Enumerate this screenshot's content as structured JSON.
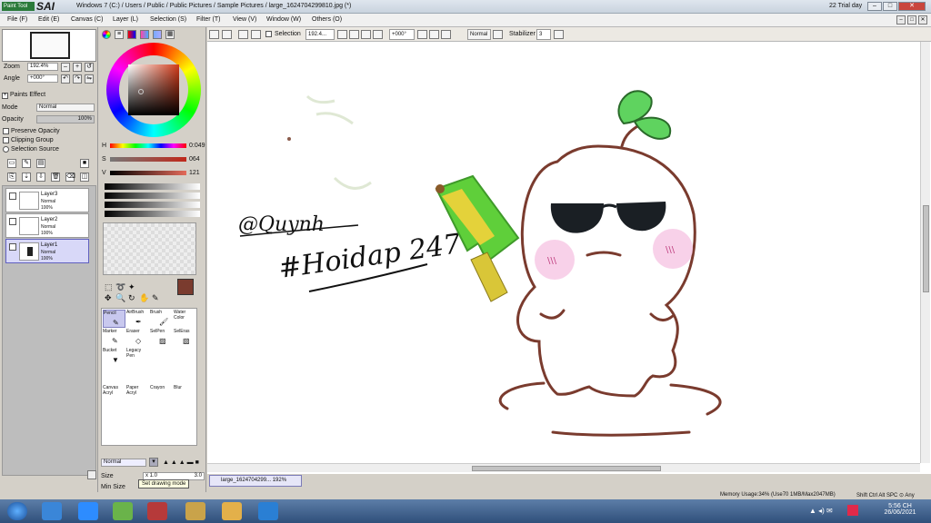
{
  "window": {
    "app_logo_text": "Paint Tool",
    "app_logo_sai": "SAI",
    "title": "Windows 7 (C:) / Users / Public / Public Pictures / Sample Pictures / large_1624704299810.jpg (*)",
    "trial": "22 Trial day"
  },
  "menu": [
    "File (F)",
    "Edit (E)",
    "Canvas (C)",
    "Layer (L)",
    "Selection (S)",
    "Filter (T)",
    "View (V)",
    "Window (W)",
    "Others (O)"
  ],
  "navigator": {
    "zoom_label": "Zoom",
    "zoom_value": "192.4%",
    "angle_label": "Angle",
    "angle_value": "+000°"
  },
  "paint_effect": {
    "title": "Paints Effect",
    "mode_label": "Mode",
    "mode_value": "Normal",
    "opacity_label": "Opacity",
    "opacity_value": "100%",
    "opacity_level": 1.0,
    "preserve_opacity": "Preserve Opacity",
    "clipping_group": "Clipping Group",
    "selection_source": "Selection Source"
  },
  "layers": [
    {
      "name": "Layer3",
      "mode": "Normal",
      "opacity": "100%",
      "selected": false
    },
    {
      "name": "Layer2",
      "mode": "Normal",
      "opacity": "100%",
      "selected": false
    },
    {
      "name": "Layer1",
      "mode": "Normal",
      "opacity": "100%",
      "selected": true
    }
  ],
  "color": {
    "current": "#7a3b2e",
    "h_label": "H",
    "h_value": "0:049",
    "s_label": "S",
    "s_value": "064",
    "v_label": "V",
    "v_value": "121"
  },
  "tools": {
    "row1": [
      "Pencil",
      "AirBrush",
      "Brush",
      "Water Color"
    ],
    "row2": [
      "Marker",
      "Eraser",
      "SelPen",
      "SelEras"
    ],
    "row3": [
      "Bucket",
      "Legacy Pen"
    ],
    "row4": [
      "Canvas Acryl",
      "Paper Acryl",
      "Crayon",
      "Blur"
    ],
    "mode_value": "Normal",
    "size_label": "Size",
    "size_multiplier": "x 1.0",
    "size_value": "3.0",
    "min_size_label": "Min Size",
    "tooltip": "Set drawing mode"
  },
  "canvas_toolbar": {
    "selection_label": "Selection",
    "zoom_value": "192.4...",
    "angle_value": "+000°",
    "mode_value": "Normal",
    "stabilizer_label": "Stabilizer",
    "stabilizer_value": "3"
  },
  "artwork": {
    "signature": "@Quynh",
    "hashtag": "#Hoidap 247"
  },
  "document_tab": {
    "label": "large_1624704299... 192%"
  },
  "status": {
    "memory": "Memory Usage:34% (Use70 1MB/Max2047MB)",
    "keys": "Shift Ctrl Alt SPC ⊙ Any"
  },
  "taskbar": {
    "time": "5:56 CH",
    "date": "26/06/2021"
  },
  "colors": {
    "stroke": "#7a3b2e",
    "leaf": "#5fd35f",
    "blush": "#f6c6e3",
    "gun": "#5fcf3a"
  }
}
